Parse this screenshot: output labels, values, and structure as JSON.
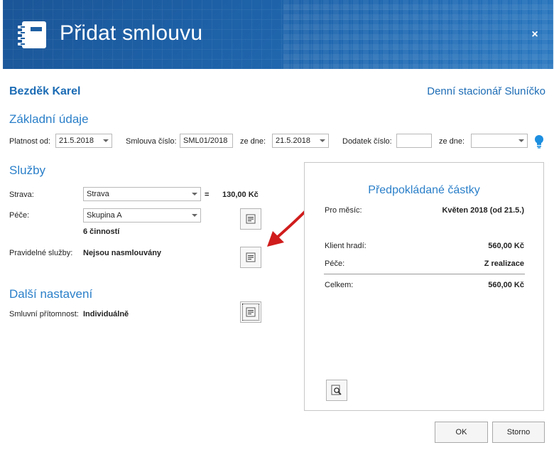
{
  "header": {
    "title": "Přidat smlouvu",
    "close_label": "×"
  },
  "client": {
    "name": "Bezděk Karel",
    "facility": "Denní stacionář Sluníčko"
  },
  "basic": {
    "title": "Základní údaje",
    "valid_from_label": "Platnost od:",
    "valid_from_value": "21.5.2018",
    "contract_no_label": "Smlouva číslo:",
    "contract_no_value": "SML01/2018",
    "from_date_label": "ze dne:",
    "from_date_value": "21.5.2018",
    "addendum_label": "Dodatek číslo:",
    "addendum_value": "",
    "addendum_date_label": "ze dne:",
    "addendum_date_value": ""
  },
  "services": {
    "title": "Služby",
    "meals_label": "Strava:",
    "meals_value": "Strava",
    "equals": "=",
    "meals_price": "130,00 Kč",
    "care_label": "Péče:",
    "care_value": "Skupina A",
    "activities_count": "6 činností",
    "regular_label": "Pravidelné služby:",
    "regular_value": "Nejsou nasmlouvány"
  },
  "other": {
    "title": "Další nastavení",
    "presence_label": "Smluvní přítomnost:",
    "presence_value": "Individuálně"
  },
  "estimate": {
    "title": "Předpokládané částky",
    "month_label": "Pro měsíc:",
    "month_value": "Květen 2018 (od 21.5.)",
    "client_pays_label": "Klient hradí:",
    "client_pays_value": "560,00 Kč",
    "care_label": "Péče:",
    "care_value": "Z realizace",
    "total_label": "Celkem:",
    "total_value": "560,00 Kč"
  },
  "footer": {
    "ok_label": "OK",
    "cancel_label": "Storno"
  },
  "colors": {
    "header_bg": "#1e5fa3",
    "accent": "#2a7fc9",
    "arrow": "#d01c1c"
  }
}
